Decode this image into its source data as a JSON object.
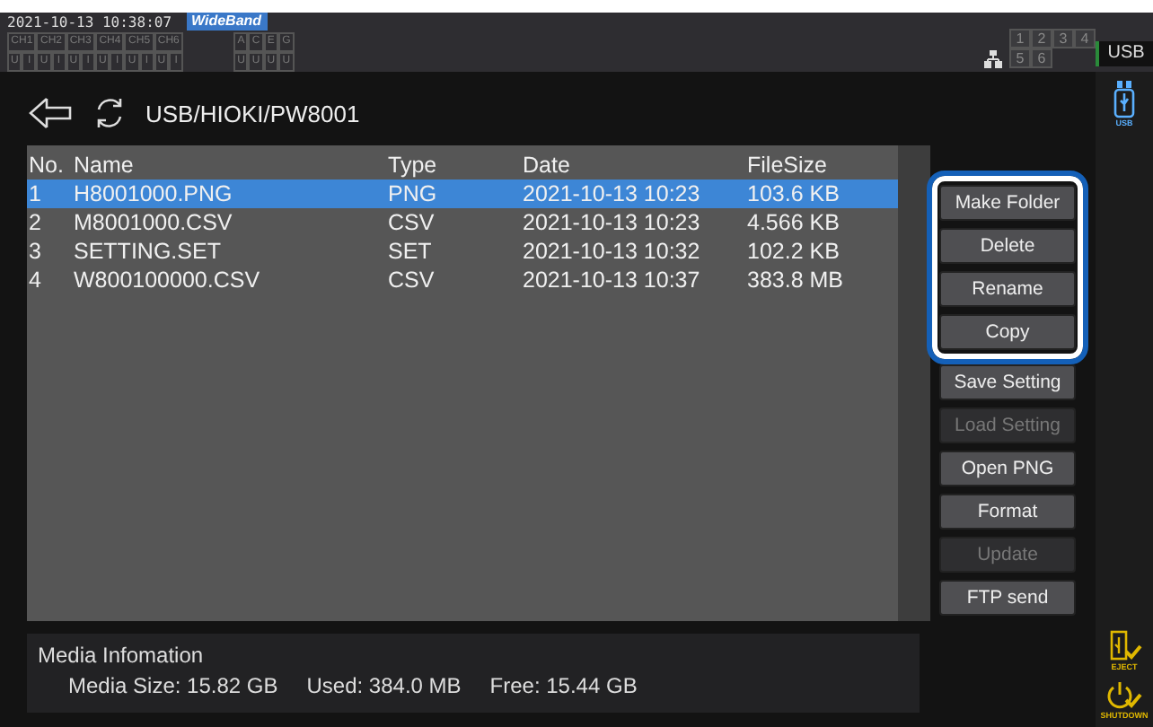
{
  "status_bar": {
    "datetime": "2021-10-13 10:38:07",
    "mode": "WideBand",
    "channels": [
      {
        "label": "CH1",
        "states": [
          "U",
          "I"
        ]
      },
      {
        "label": "CH2",
        "states": [
          "U",
          "I"
        ]
      },
      {
        "label": "CH3",
        "states": [
          "U",
          "I"
        ]
      },
      {
        "label": "CH4",
        "states": [
          "U",
          "I"
        ]
      },
      {
        "label": "CH5",
        "states": [
          "U",
          "I"
        ]
      },
      {
        "label": "CH6",
        "states": [
          "U",
          "I"
        ]
      }
    ],
    "motors": [
      {
        "label": "A",
        "state": "U"
      },
      {
        "label": "C",
        "state": "U"
      },
      {
        "label": "E",
        "state": "U"
      },
      {
        "label": "G",
        "state": "U"
      }
    ],
    "ports": [
      "1",
      "2",
      "3",
      "4",
      "5",
      "6"
    ],
    "media_tab": "USB"
  },
  "path": "USB/HIOKI/PW8001",
  "table": {
    "columns": [
      "No.",
      "Name",
      "Type",
      "Date",
      "FileSize"
    ],
    "rows": [
      {
        "no": "1",
        "name": "H8001000.PNG",
        "type": "PNG",
        "date": "2021-10-13 10:23",
        "size": "103.6 KB",
        "selected": true
      },
      {
        "no": "2",
        "name": "M8001000.CSV",
        "type": "CSV",
        "date": "2021-10-13 10:23",
        "size": "4.566 KB",
        "selected": false
      },
      {
        "no": "3",
        "name": "SETTING.SET",
        "type": "SET",
        "date": "2021-10-13 10:32",
        "size": "102.2 KB",
        "selected": false
      },
      {
        "no": "4",
        "name": "W800100000.CSV",
        "type": "CSV",
        "date": "2021-10-13 10:37",
        "size": "383.8 MB",
        "selected": false
      }
    ]
  },
  "button_groups": [
    {
      "highlighted": true,
      "buttons": [
        {
          "label": "Make Folder",
          "disabled": false
        },
        {
          "label": "Delete",
          "disabled": false
        },
        {
          "label": "Rename",
          "disabled": false
        },
        {
          "label": "Copy",
          "disabled": false
        }
      ]
    },
    {
      "highlighted": false,
      "buttons": [
        {
          "label": "Save Setting",
          "disabled": false
        },
        {
          "label": "Load Setting",
          "disabled": true
        },
        {
          "label": "Open PNG",
          "disabled": false
        },
        {
          "label": "Format",
          "disabled": false
        },
        {
          "label": "Update",
          "disabled": true
        },
        {
          "label": "FTP send",
          "disabled": false
        }
      ]
    }
  ],
  "media_info": {
    "title": "Media Infomation",
    "size": "Media Size: 15.82 GB",
    "used": "Used: 384.0 MB",
    "free": "Free: 15.44 GB"
  },
  "side_icons": [
    {
      "kind": "usb",
      "label": "USB"
    },
    {
      "kind": "eject",
      "label": "EJECT"
    },
    {
      "kind": "shutdown",
      "label": "SHUTDOWN"
    }
  ]
}
